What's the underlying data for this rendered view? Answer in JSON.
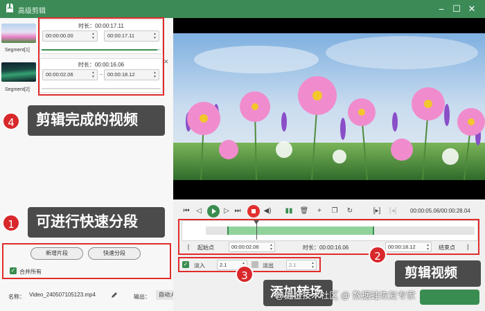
{
  "window": {
    "title": "高级剪辑",
    "minimize": "⎯",
    "maximize": "☐",
    "close": "✕"
  },
  "segments": [
    {
      "label": "Segment[1]",
      "duration": "时长：00:00:17.11",
      "start": "00:00:00.00",
      "end": "00:00:17.11",
      "progress": 0.97
    },
    {
      "label": "Segment[2]",
      "duration": "时长：00:00:16.06",
      "start": "00:00:02.06",
      "end": "00:00:18.12",
      "progress": 0.0
    }
  ],
  "segment_close": "✕",
  "callouts": [
    {
      "num": "4",
      "text": "剪辑完成的视频"
    },
    {
      "num": "1",
      "text": "可进行快速分段"
    },
    {
      "num": "3",
      "text": "添加转场"
    },
    {
      "num": "2",
      "text": "剪辑视频"
    }
  ],
  "buttons": {
    "new_segment": "新增片段",
    "quick_split": "快速分段",
    "merge_all": "合并所有"
  },
  "file": {
    "name_label": "名称：",
    "name_value": "Video_240507105123.mp4",
    "output_label": "输出：",
    "output_value": "自动;Auto"
  },
  "player": {
    "time": "00:00:05.06/00:00:28.04"
  },
  "timeline": {
    "start_label": "起始点",
    "start_value": "00:00:02.06",
    "duration": "时长：00:00:16.06",
    "end_value": "00:00:18.12",
    "end_label": "结束点",
    "sel_start": 0.08,
    "sel_end": 0.626,
    "playhead": 0.19
  },
  "fade": {
    "in_label": "淡入",
    "in_value": "2.1",
    "out_label": "淡出",
    "out_value": "2.1",
    "in_checked": true,
    "out_checked": false
  },
  "watermark": "@掘金技术社区 @ 数据蛙恢复专家",
  "colors": {
    "accent": "#3a8d50",
    "title_bar": "#3c8b57",
    "highlight": "#e12b2b",
    "callout_bg": "#4b4b4b"
  }
}
